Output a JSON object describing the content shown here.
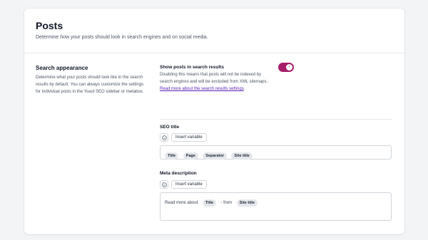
{
  "header": {
    "title": "Posts",
    "description": "Determine how your posts should look in search engines and on social media."
  },
  "section": {
    "title": "Search appearance",
    "description": "Determine what your posts should look like in the search results by default. You can always customize the settings for individual posts in the Yoast SEO sidebar or metabox."
  },
  "toggle": {
    "label": "Show posts in search results",
    "state": "on",
    "accent_color": "#a61e69",
    "description": "Disabling this means that posts will not be indexed by search engines and will be excluded from XML sitemaps.",
    "link_text": "Read more about the search results settings",
    "after_link": "."
  },
  "seo_title": {
    "label": "SEO title",
    "insert_variable": "Insert variable",
    "pills": [
      "Title",
      "Page",
      "Separator",
      "Site title"
    ]
  },
  "meta_description": {
    "label": "Meta description",
    "insert_variable": "Insert variable",
    "prefix_text": "Read more about",
    "pill_1": "Title",
    "middle_text": "- from",
    "pill_2": "Site title"
  },
  "icons": {
    "emoji": "emoji-smile-icon",
    "toggle_check": "check-icon"
  }
}
